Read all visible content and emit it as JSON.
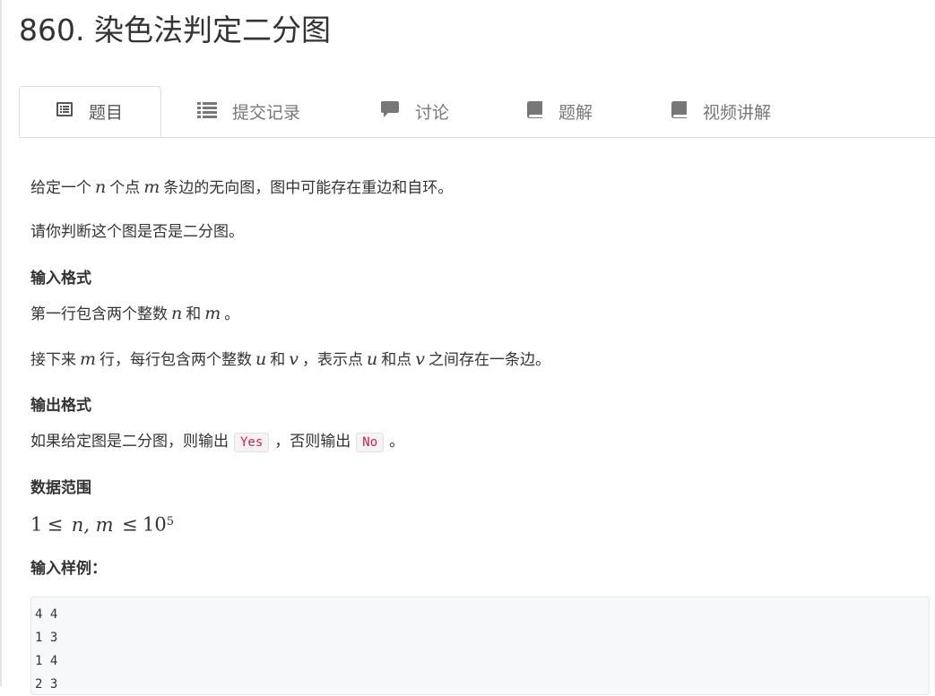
{
  "page": {
    "title": "860. 染色法判定二分图"
  },
  "tabs": [
    {
      "label": "题目",
      "icon": "list-alt-icon",
      "active": true
    },
    {
      "label": "提交记录",
      "icon": "list-icon",
      "active": false
    },
    {
      "label": "讨论",
      "icon": "comment-icon",
      "active": false
    },
    {
      "label": "题解",
      "icon": "book-icon",
      "active": false
    },
    {
      "label": "视频讲解",
      "icon": "book-icon",
      "active": false
    }
  ],
  "problem": {
    "desc1": {
      "a": "给定一个",
      "n": "n",
      "b": "个点",
      "m": "m",
      "c": "条边的无向图，图中可能存在重边和自环。"
    },
    "desc2": "请你判断这个图是否是二分图。",
    "input_heading": "输入格式",
    "input1": {
      "a": "第一行包含两个整数",
      "n": "n",
      "b": "和",
      "m": "m",
      "c": "。"
    },
    "input2": {
      "a": "接下来",
      "m": "m",
      "b": "行，每行包含两个整数",
      "u": "u",
      "c": "和",
      "v": "v",
      "d": "，表示点",
      "u2": "u",
      "e": "和点",
      "v2": "v",
      "f": "之间存在一条边。"
    },
    "output_heading": "输出格式",
    "output1": {
      "a": "如果给定图是二分图，则输出",
      "yes": "Yes",
      "b": "，否则输出",
      "no": "No",
      "c": "。"
    },
    "range_heading": "数据范围",
    "range": {
      "one": "1",
      "le1": "≤",
      "nm": "n, m",
      "le2": "≤",
      "ten": "10",
      "exp": "5"
    },
    "sample_heading": "输入样例：",
    "sample_lines": [
      "4 4",
      "1 3",
      "1 4",
      "2 3"
    ]
  }
}
